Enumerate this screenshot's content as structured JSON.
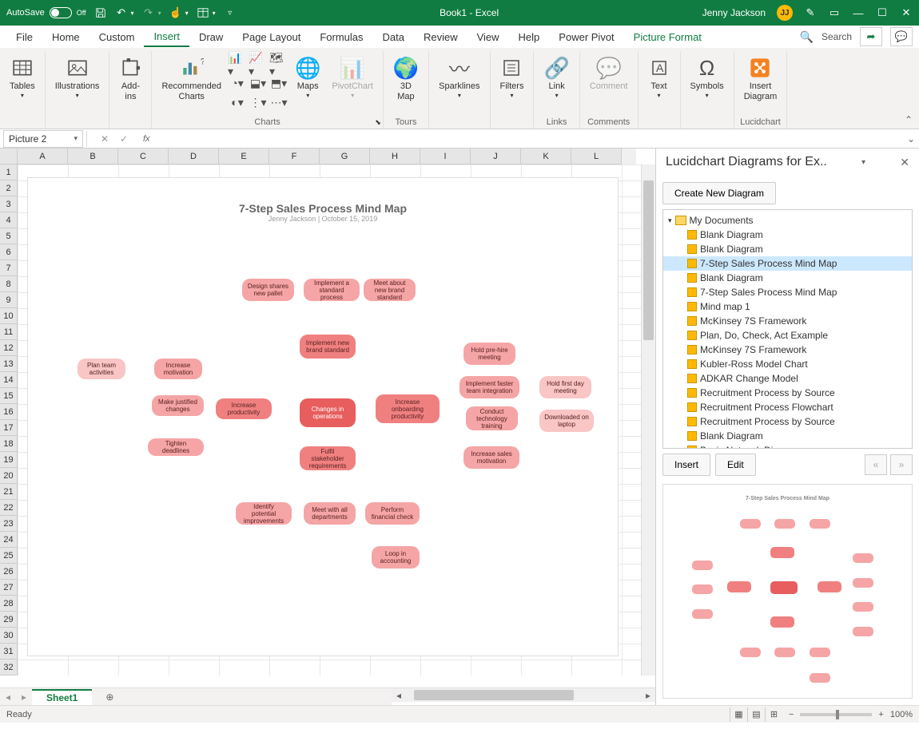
{
  "titlebar": {
    "autosave_label": "AutoSave",
    "autosave_state": "Off",
    "title": "Book1  -  Excel",
    "user_name": "Jenny Jackson",
    "user_initials": "JJ"
  },
  "tabs": [
    "File",
    "Home",
    "Custom",
    "Insert",
    "Draw",
    "Page Layout",
    "Formulas",
    "Data",
    "Review",
    "View",
    "Help",
    "Power Pivot",
    "Picture Format"
  ],
  "active_tab": "Insert",
  "search_label": "Search",
  "ribbon": {
    "tables": "Tables",
    "illustrations": "Illustrations",
    "addins": "Add-\nins",
    "recommended_charts": "Recommended\nCharts",
    "charts_group": "Charts",
    "maps": "Maps",
    "pivotchart": "PivotChart",
    "map3d": "3D\nMap",
    "tours_group": "Tours",
    "sparklines": "Sparklines",
    "filters": "Filters",
    "link": "Link",
    "links_group": "Links",
    "comment": "Comment",
    "comments_group": "Comments",
    "text": "Text",
    "symbols": "Symbols",
    "insert_diagram": "Insert\nDiagram",
    "lucidchart_group": "Lucidchart"
  },
  "namebox": "Picture 2",
  "columns": [
    "A",
    "B",
    "C",
    "D",
    "E",
    "F",
    "G",
    "H",
    "I",
    "J",
    "K",
    "L"
  ],
  "rows_count": 32,
  "diagram": {
    "title": "7-Step Sales Process Mind Map",
    "subtitle": "Jenny Jackson   |   October 15, 2019",
    "center": "Changes in operations",
    "nodes": {
      "inc_prod": "Increase productivity",
      "impl_brand": "Implement new brand standard",
      "inc_onboard": "Increase onboarding productivity",
      "fulfil_stake": "Fulfil stakeholder requirements",
      "plan_team": "Plan team activities",
      "inc_motiv": "Increase motivation",
      "make_changes": "Make justified changes",
      "tighten": "Tighten deadlines",
      "design_pallet": "Design shares new pallet",
      "impl_std_proc": "Implement a standard process",
      "meet_brand": "Meet about new brand standard",
      "hold_prehire": "Hold pre-hire meeting",
      "impl_faster": "Implement faster team integration",
      "conduct_tech": "Conduct technology training",
      "inc_sales_motiv": "Increase sales motivation",
      "hold_firstday": "Hold first day meeting",
      "download_laptop": "Downloaded on laptop",
      "identify_impr": "Identify potential improvements",
      "meet_depts": "Meet with all departments",
      "perform_fin": "Perform financial check",
      "loop_acct": "Loop in accounting"
    }
  },
  "sheet_tab": "Sheet1",
  "taskpane": {
    "title": "Lucidchart Diagrams for Ex..",
    "create_btn": "Create New Diagram",
    "folder": "My Documents",
    "docs": [
      "Blank Diagram",
      "Blank Diagram",
      "7-Step Sales Process Mind Map",
      "Blank Diagram",
      "7-Step Sales Process Mind Map",
      "Mind map 1",
      "McKinsey 7S Framework",
      "Plan, Do, Check, Act Example",
      "McKinsey 7S Framework",
      "Kubler-Ross Model Chart",
      "ADKAR Change Model",
      "Recruitment Process by Source",
      "Recruitment Process Flowchart",
      "Recruitment Process by Source",
      "Blank Diagram",
      "Basic Network Diagram"
    ],
    "selected_index": 2,
    "insert_btn": "Insert",
    "edit_btn": "Edit"
  },
  "statusbar": {
    "ready": "Ready",
    "zoom": "100%"
  }
}
